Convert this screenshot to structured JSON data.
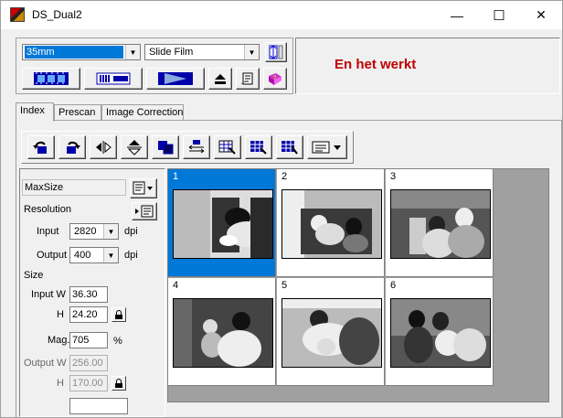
{
  "window": {
    "title": "DS_Dual2",
    "minimize": "—",
    "maximize": "☐",
    "close": "✕"
  },
  "top": {
    "film_size": "35mm",
    "film_type": "Slide Film",
    "status_message": "En het werkt"
  },
  "tabs": [
    {
      "label": "Index",
      "active": true
    },
    {
      "label": "Prescan",
      "active": false
    },
    {
      "label": "Image Correction",
      "active": false
    }
  ],
  "settings": {
    "preset": "MaxSize",
    "resolution_label": "Resolution",
    "input_label": "Input",
    "input_value": "2820",
    "output_label": "Output",
    "output_value": "400",
    "dpi_unit": "dpi",
    "size_label": "Size",
    "input_w_label": "Input W",
    "input_w": "36.30",
    "input_h_label": "H",
    "input_h": "24.20",
    "mag_label": "Mag.",
    "mag": "705",
    "mag_unit": "%",
    "output_w_label": "Output W",
    "output_w": "256.00",
    "output_h_label": "H",
    "output_h": "170.00"
  },
  "frames": [
    {
      "number": "1",
      "selected": true
    },
    {
      "number": "2",
      "selected": false
    },
    {
      "number": "3",
      "selected": false
    },
    {
      "number": "4",
      "selected": false
    },
    {
      "number": "5",
      "selected": false
    },
    {
      "number": "6",
      "selected": false
    }
  ],
  "colors": {
    "selection": "#0078d7",
    "status_text": "#c00000",
    "grid_bg": "#a0a0a0"
  }
}
